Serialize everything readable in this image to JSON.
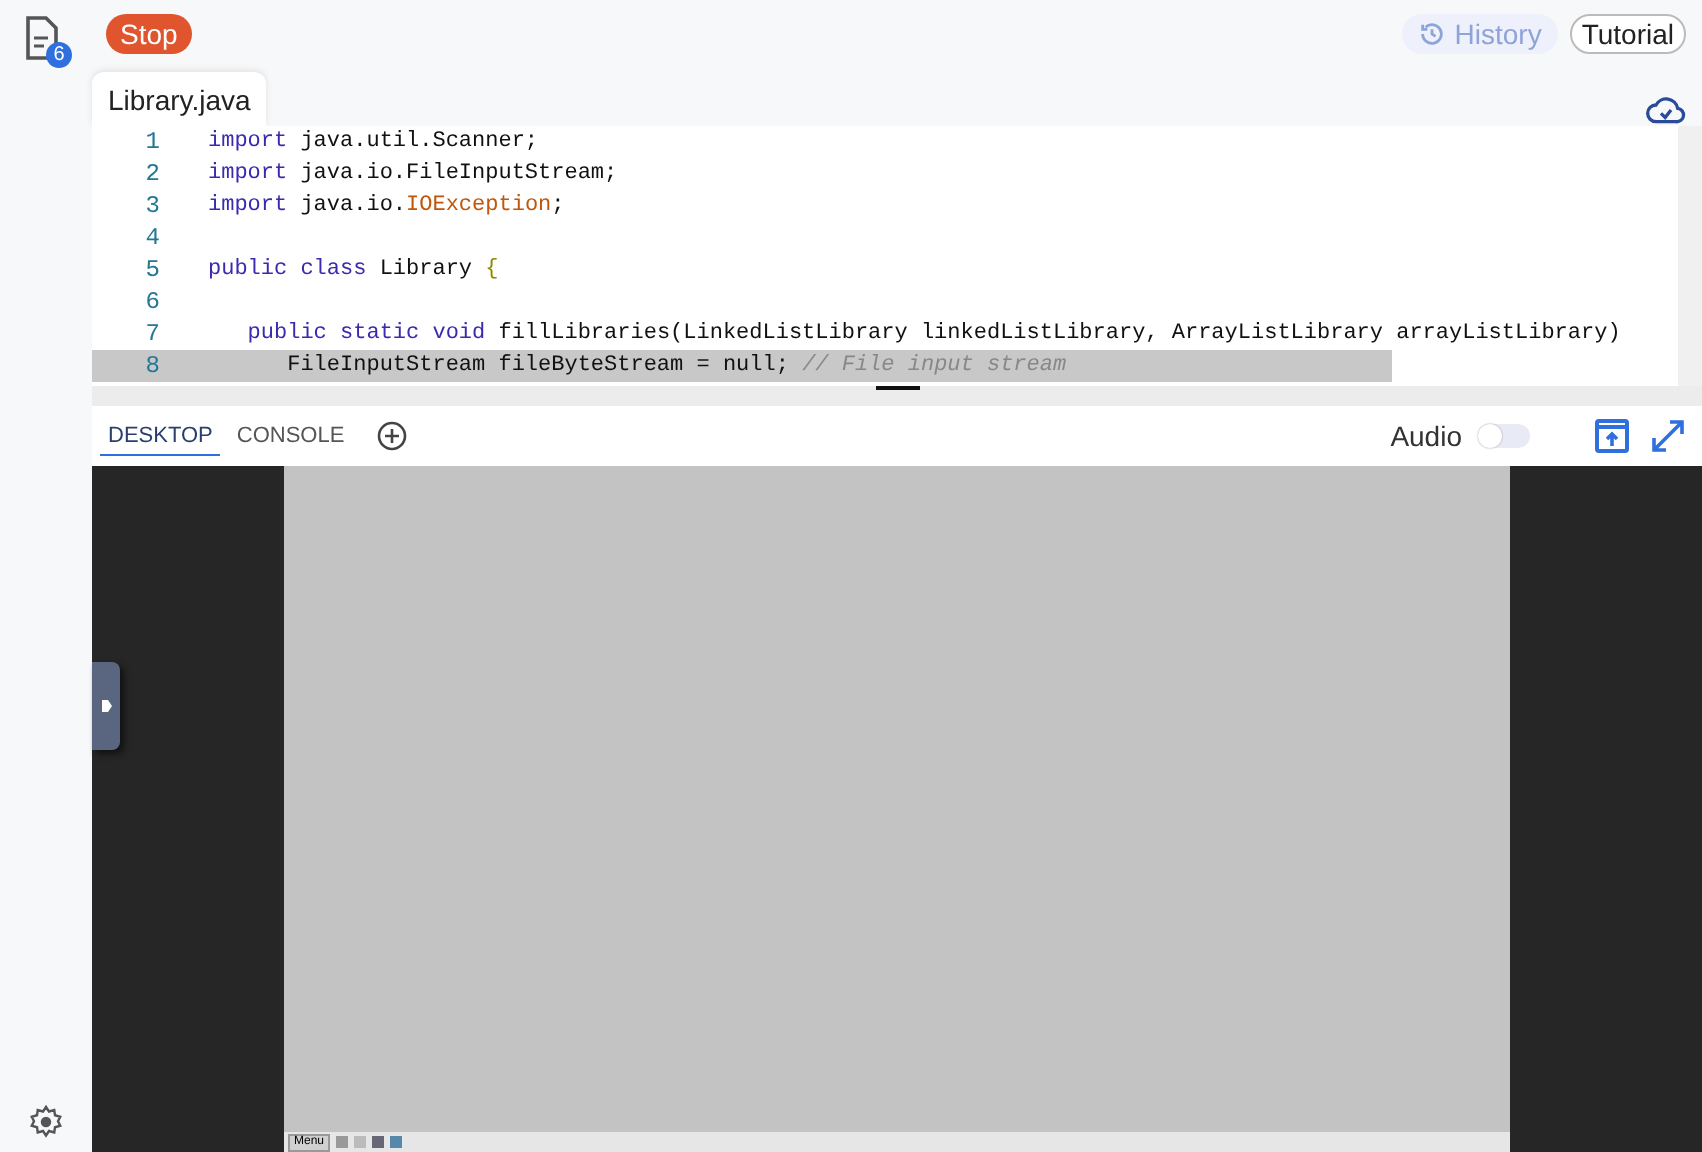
{
  "sidebar": {
    "files_badge": "6"
  },
  "toolbar": {
    "stop": "Stop",
    "history": "History",
    "tutorial": "Tutorial"
  },
  "editor": {
    "tabs": [
      {
        "label": "Library.java",
        "selected": true
      }
    ],
    "lines": [
      {
        "number": "1",
        "tokens": [
          {
            "text": "import",
            "kind": "keyword"
          },
          {
            "text": " java.util.Scanner;",
            "kind": "plain"
          }
        ]
      },
      {
        "number": "2",
        "tokens": [
          {
            "text": "import",
            "kind": "keyword"
          },
          {
            "text": " java.io.FileInputStream;",
            "kind": "plain"
          }
        ]
      },
      {
        "number": "3",
        "tokens": [
          {
            "text": "import",
            "kind": "keyword"
          },
          {
            "text": " java.io.",
            "kind": "plain"
          },
          {
            "text": "IOException",
            "kind": "type"
          },
          {
            "text": ";",
            "kind": "plain"
          }
        ]
      },
      {
        "number": "4"
      },
      {
        "number": "5",
        "tokens": [
          {
            "text": "public class",
            "kind": "keyword"
          },
          {
            "text": " Library ",
            "kind": "plain"
          },
          {
            "text": "{",
            "kind": "brace"
          }
        ]
      },
      {
        "number": "6"
      },
      {
        "number": "7",
        "tokens": [
          {
            "text": "   public static void",
            "kind": "keyword"
          },
          {
            "text": " fillLibraries(LinkedListLibrary linkedListLibrary, ArrayListLibrary arrayListLibrary)",
            "kind": "plain"
          }
        ]
      },
      {
        "number": "8",
        "tokens": [
          {
            "text": "      FileInputStream fileByteStream = null; ",
            "kind": "plain"
          },
          {
            "text": "// File input stream",
            "kind": "comment"
          }
        ]
      }
    ]
  },
  "panel": {
    "tabs": [
      {
        "label": "DESKTOP",
        "selected": true
      },
      {
        "label": "CONSOLE",
        "selected": false
      }
    ],
    "audio": {
      "label": "Audio",
      "on": false
    }
  },
  "desktop": {
    "taskbar_menu": "Menu"
  }
}
